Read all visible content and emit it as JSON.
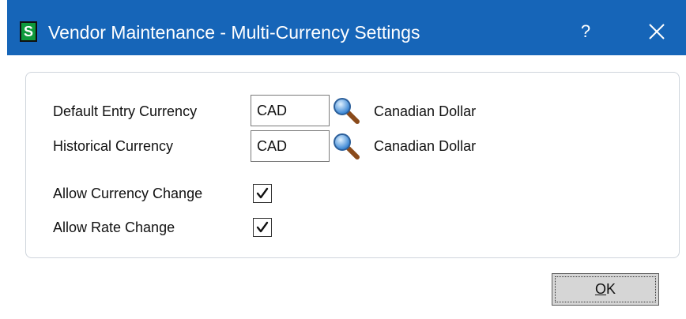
{
  "window": {
    "title": "Vendor Maintenance - Multi-Currency Settings",
    "app_icon_letter": "S",
    "help_label": "?",
    "titlebar_color": "#1665b8",
    "app_icon_color": "#0e9a3b"
  },
  "form": {
    "default_entry_currency": {
      "label": "Default Entry Currency",
      "value": "CAD",
      "description": "Canadian Dollar"
    },
    "historical_currency": {
      "label": "Historical Currency",
      "value": "CAD",
      "description": "Canadian Dollar"
    },
    "allow_currency_change": {
      "label": "Allow Currency Change",
      "checked": true
    },
    "allow_rate_change": {
      "label": "Allow Rate Change",
      "checked": true
    }
  },
  "buttons": {
    "ok_mnemonic": "O",
    "ok_rest": "K"
  }
}
